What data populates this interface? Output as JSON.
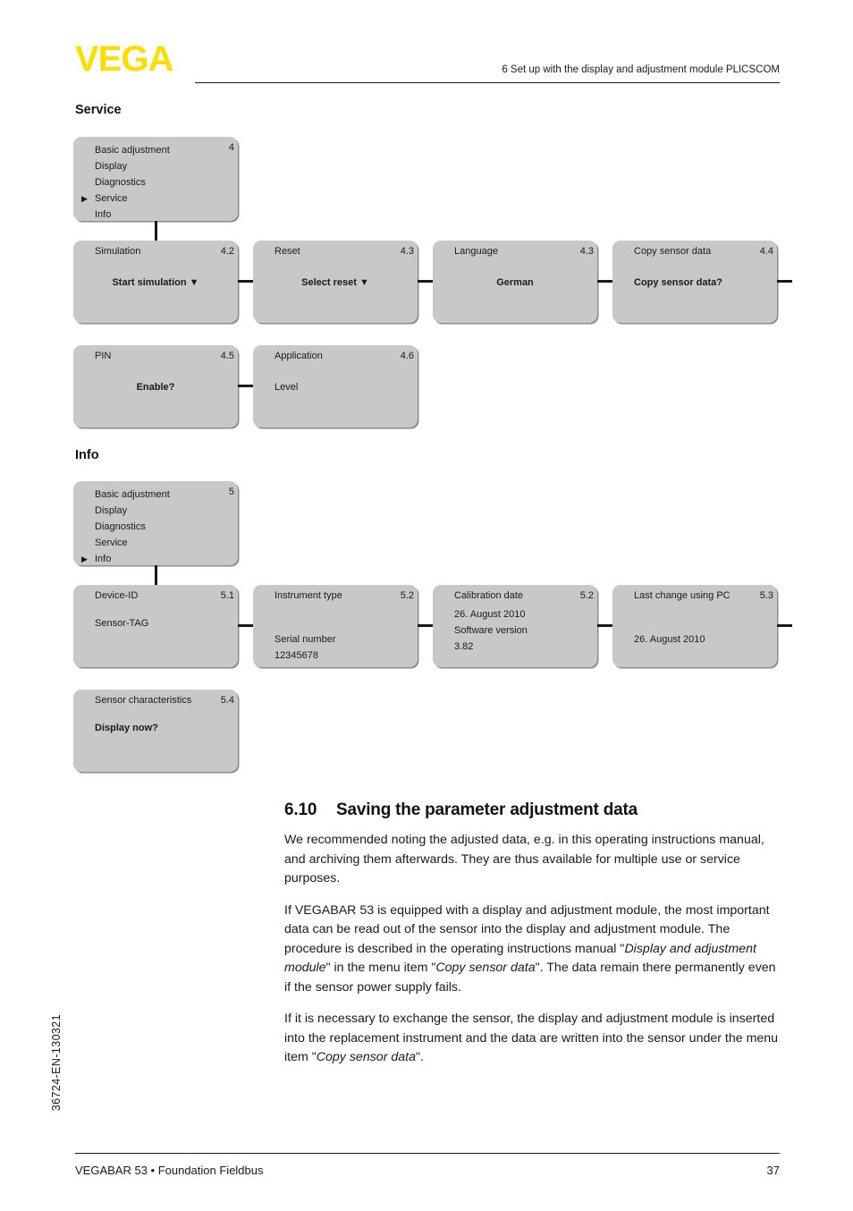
{
  "header": {
    "logo_text": "VEGA",
    "title": "6 Set up with the display and adjustment module PLICSCOM",
    "logo_color": "#ffdd00"
  },
  "sections": [
    {
      "id": "service",
      "heading": "Service"
    },
    {
      "id": "info",
      "heading": "Info"
    }
  ],
  "service_menu": {
    "number": "4",
    "items": [
      {
        "label": "Basic adjustment",
        "selected": false
      },
      {
        "label": "Display",
        "selected": false
      },
      {
        "label": "Diagnostics",
        "selected": false
      },
      {
        "label": "Service",
        "selected": true
      },
      {
        "label": "Info",
        "selected": false
      }
    ]
  },
  "service_nodes": [
    {
      "title": "Simulation",
      "number": "4.2",
      "lines": [
        {
          "text": "Start simulation ▼",
          "bold": true
        }
      ],
      "align": "center"
    },
    {
      "title": "Reset",
      "number": "4.3",
      "lines": [
        {
          "text": "Select reset ▼",
          "bold": true
        }
      ],
      "align": "center"
    },
    {
      "title": "Language",
      "number": "4.3",
      "lines": [
        {
          "text": "German",
          "bold": true
        }
      ],
      "align": "center"
    },
    {
      "title": "Copy sensor data",
      "number": "4.4",
      "lines": [
        {
          "text": "Copy sensor data?",
          "bold": true
        }
      ],
      "align": "left"
    },
    {
      "title": "PIN",
      "number": "4.5",
      "lines": [
        {
          "text": "Enable?",
          "bold": true
        }
      ],
      "align": "center"
    },
    {
      "title": "Application",
      "number": "4.6",
      "lines": [
        {
          "text": "Level",
          "bold": false
        }
      ],
      "align": "left"
    }
  ],
  "info_menu": {
    "number": "5",
    "items": [
      {
        "label": "Basic adjustment",
        "selected": false
      },
      {
        "label": "Display",
        "selected": false
      },
      {
        "label": "Diagnostics",
        "selected": false
      },
      {
        "label": "Service",
        "selected": false
      },
      {
        "label": "Info",
        "selected": true
      }
    ]
  },
  "info_nodes": [
    {
      "title": "Device-ID",
      "number": "5.1",
      "lines": [
        {
          "text": "Sensor-TAG",
          "bold": false
        }
      ],
      "align": "left"
    },
    {
      "title": "Instrument type",
      "number": "5.2",
      "lines": [
        {
          "text": "Serial number",
          "bold": false
        },
        {
          "text": "12345678",
          "bold": false
        }
      ],
      "align": "left"
    },
    {
      "title": "Calibration date",
      "number": "5.2",
      "lines": [
        {
          "text": "26. August 2010",
          "bold": false
        },
        {
          "text": "Software version",
          "bold": false
        },
        {
          "text": "3.82",
          "bold": false
        }
      ],
      "align": "left"
    },
    {
      "title": "Last change using PC",
      "number": "5.3",
      "lines": [
        {
          "text": "26. August 2010",
          "bold": false
        }
      ],
      "align": "left"
    },
    {
      "title": "Sensor characteristics",
      "number": "5.4",
      "lines": [
        {
          "text": "Display now?",
          "bold": true
        }
      ],
      "align": "left"
    }
  ],
  "chapter": {
    "number": "6.10",
    "title": "Saving the parameter adjustment data",
    "paragraph1": "We recommended noting the adjusted data, e.g. in this operating instructions manual, and archiving them afterwards. They are thus available for multiple use or service purposes.",
    "paragraph2_part1": "If VEGABAR 53 is equipped with a display and adjustment module, the most important data can be read out of the sensor into the display and adjustment module. The procedure is described in the operating instructions manual \"",
    "paragraph2_italic1": "Display and adjustment module",
    "paragraph2_part2": "\" in the menu item \"",
    "paragraph2_italic2": "Copy sensor data",
    "paragraph2_part3": "\". The data remain there permanently even if the sensor power supply fails.",
    "paragraph3_part1": "If it is necessary to exchange the sensor, the display and adjustment module is inserted into the replacement instrument and the data are written into the sensor under the menu item \"",
    "paragraph3_italic1": "Copy sensor data",
    "paragraph3_part2": "\"."
  },
  "footer": {
    "doc_number": "36724-EN-130321",
    "left": "VEGABAR 53 • Foundation Fieldbus",
    "page": "37"
  }
}
